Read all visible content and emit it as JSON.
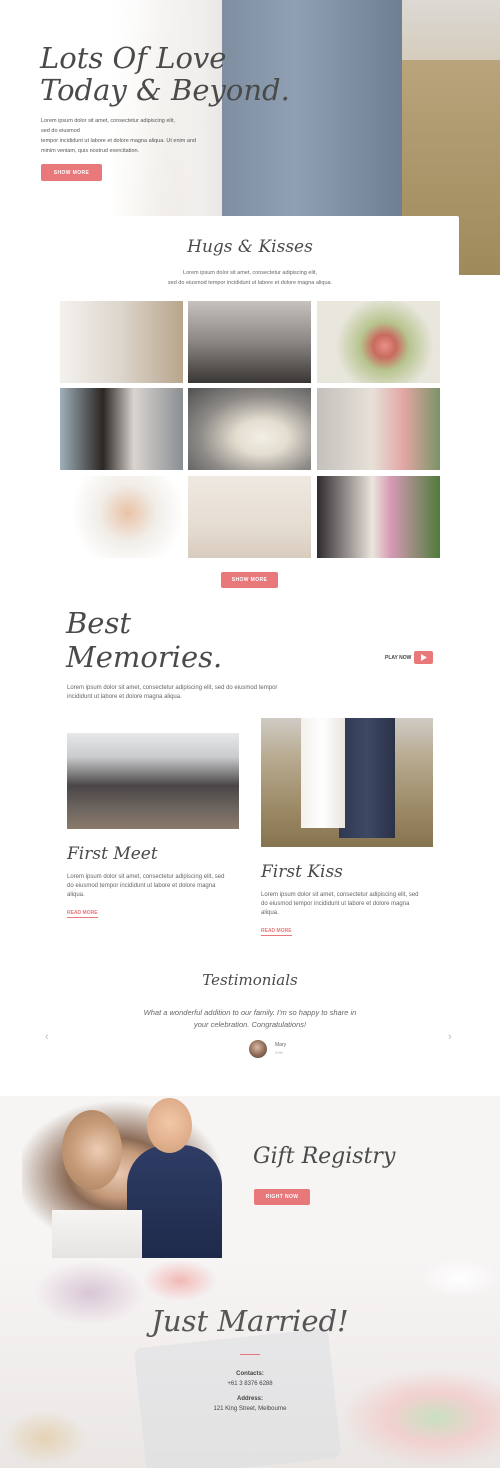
{
  "hero": {
    "title_line1": "Lots Of Love",
    "title_line2": "Today & Beyond.",
    "text_line1": "Lorem ipsum dolor sit amet, consectetur adipiscing elit,",
    "text_line2": "sed do eiusmod",
    "text_line3": "tempor incididunt ut labore et dolore magna aliqua. Ut enim and",
    "text_line4": "minim veniam, quis nostrud exercitation.",
    "button": "SHOW MORE"
  },
  "gallery": {
    "title": "Hugs & Kisses",
    "text_line1": "Lorem ipsum dolor sit amet, consectetur adipiscing elit,",
    "text_line2": "sed do eiusmod tempor incididunt ut labore et dolore magna aliqua.",
    "button": "SHOW MORE"
  },
  "memories": {
    "title_line1": "Best",
    "title_line2": "Memories.",
    "play_label": "PLAY NOW",
    "text_line1": "Lorem ipsum dolor sit amet, consectetur adipiscing elit, sed do eiusmod tempor",
    "text_line2": "incididunt ut labore et dolore magna aliqua.",
    "cards": [
      {
        "title": "First Meet",
        "text_line1": "Lorem ipsum dolor sit amet, consectetur adipiscing elit, sed",
        "text_line2": "do eiusmod tempor incididunt ut labore et dolore magna",
        "text_line3": "aliqua.",
        "link": "READ MORE"
      },
      {
        "title": "First Kiss",
        "text_line1": "Lorem ipsum dolor sit amet, consectetur adipiscing elit, sed",
        "text_line2": "do eiusmod tempor incididunt ut labore et dolore magna",
        "text_line3": "aliqua.",
        "link": "READ MORE"
      }
    ]
  },
  "testimonials": {
    "title": "Testimonials",
    "quote_line1": "What a wonderful addition to our family. I'm so happy to share in",
    "quote_line2": "your celebration. Congratulations!",
    "author": "Mary",
    "author_sub": "Wife",
    "prev": "‹",
    "next": "›"
  },
  "gift": {
    "title": "Gift Registry",
    "button": "RIGHT NOW"
  },
  "footer": {
    "title": "Just Married!",
    "contacts_label": "Contacts:",
    "phone": "+61 3 8376 6288",
    "address_label": "Address:",
    "address": "121 King Street, Melbourne"
  },
  "colors": {
    "accent": "#e9787b",
    "text": "#555555",
    "background": "#ffffff"
  },
  "icons": {
    "play": "play-icon",
    "prev": "chevron-left-icon",
    "next": "chevron-right-icon"
  }
}
